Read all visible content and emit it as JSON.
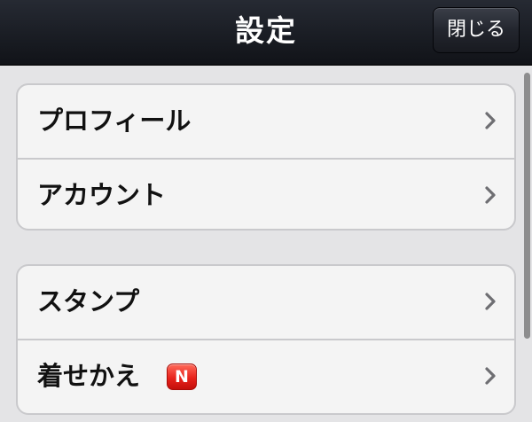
{
  "navbar": {
    "title": "設定",
    "close_label": "閉じる"
  },
  "groups": [
    {
      "items": [
        {
          "label": "プロフィール"
        },
        {
          "label": "アカウント"
        }
      ]
    },
    {
      "items": [
        {
          "label": "スタンプ"
        },
        {
          "label": "着せかえ",
          "badge": "N"
        }
      ]
    }
  ],
  "icons": {
    "row_disclosure": "chevron-right-icon"
  },
  "colors": {
    "navbar_bg": "#1a1d24",
    "badge_red": "#e8231c",
    "page_bg": "#e4e4e6"
  }
}
